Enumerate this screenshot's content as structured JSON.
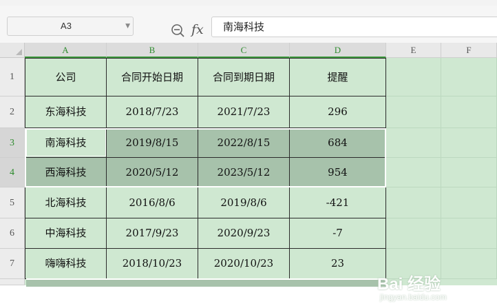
{
  "name_box": {
    "value": "A3"
  },
  "formula_bar": {
    "fx_label": "fx",
    "value": "南海科技"
  },
  "columns": [
    "A",
    "B",
    "C",
    "D",
    "E",
    "F"
  ],
  "rows": [
    "1",
    "2",
    "3",
    "4",
    "5",
    "6",
    "7"
  ],
  "table": {
    "headers": [
      "公司",
      "合同开始日期",
      "合同到期日期",
      "提醒"
    ],
    "data": [
      [
        "东海科技",
        "2018/7/23",
        "2021/7/23",
        "296"
      ],
      [
        "南海科技",
        "2019/8/15",
        "2022/8/15",
        "684"
      ],
      [
        "西海科技",
        "2020/5/12",
        "2023/5/12",
        "954"
      ],
      [
        "北海科技",
        "2016/8/6",
        "2019/8/6",
        "-421"
      ],
      [
        "中海科技",
        "2017/9/23",
        "2020/9/23",
        "-7"
      ],
      [
        "嗨嗨科技",
        "2018/10/23",
        "2020/10/23",
        "23"
      ]
    ]
  },
  "watermark": {
    "text": "Bai 经验",
    "sub": "jingyan.baidu.com"
  },
  "colors": {
    "grid_bg": "#cfe8d1",
    "highlight": "#a7c2ab",
    "selection_accent": "#3c9a3c"
  }
}
